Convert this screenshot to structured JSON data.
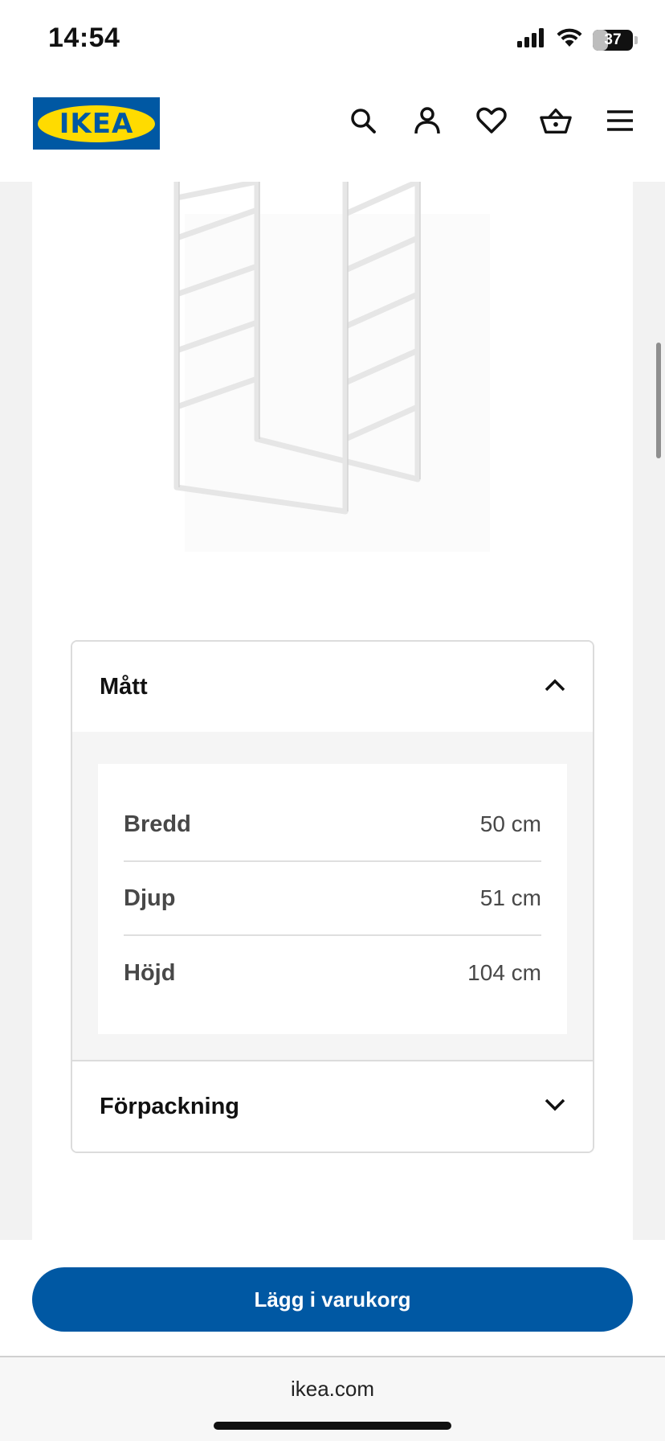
{
  "status_bar": {
    "time": "14:54",
    "battery_level": "37",
    "battery_fraction": 0.37
  },
  "header": {
    "logo_text": "IKEA",
    "icons": [
      "search-icon",
      "user-icon",
      "heart-icon",
      "basket-icon",
      "menu-icon"
    ]
  },
  "accordion": {
    "dimensions": {
      "title": "Mått",
      "rows": [
        {
          "label": "Bredd",
          "value": "50 cm"
        },
        {
          "label": "Djup",
          "value": "51 cm"
        },
        {
          "label": "Höjd",
          "value": "104 cm"
        }
      ]
    },
    "packaging": {
      "title": "Förpackning"
    }
  },
  "cta": {
    "add_to_cart_label": "Lägg i varukorg"
  },
  "browser": {
    "url": "ikea.com"
  },
  "colors": {
    "brand_blue": "#0058a3",
    "brand_yellow": "#ffdb00"
  }
}
